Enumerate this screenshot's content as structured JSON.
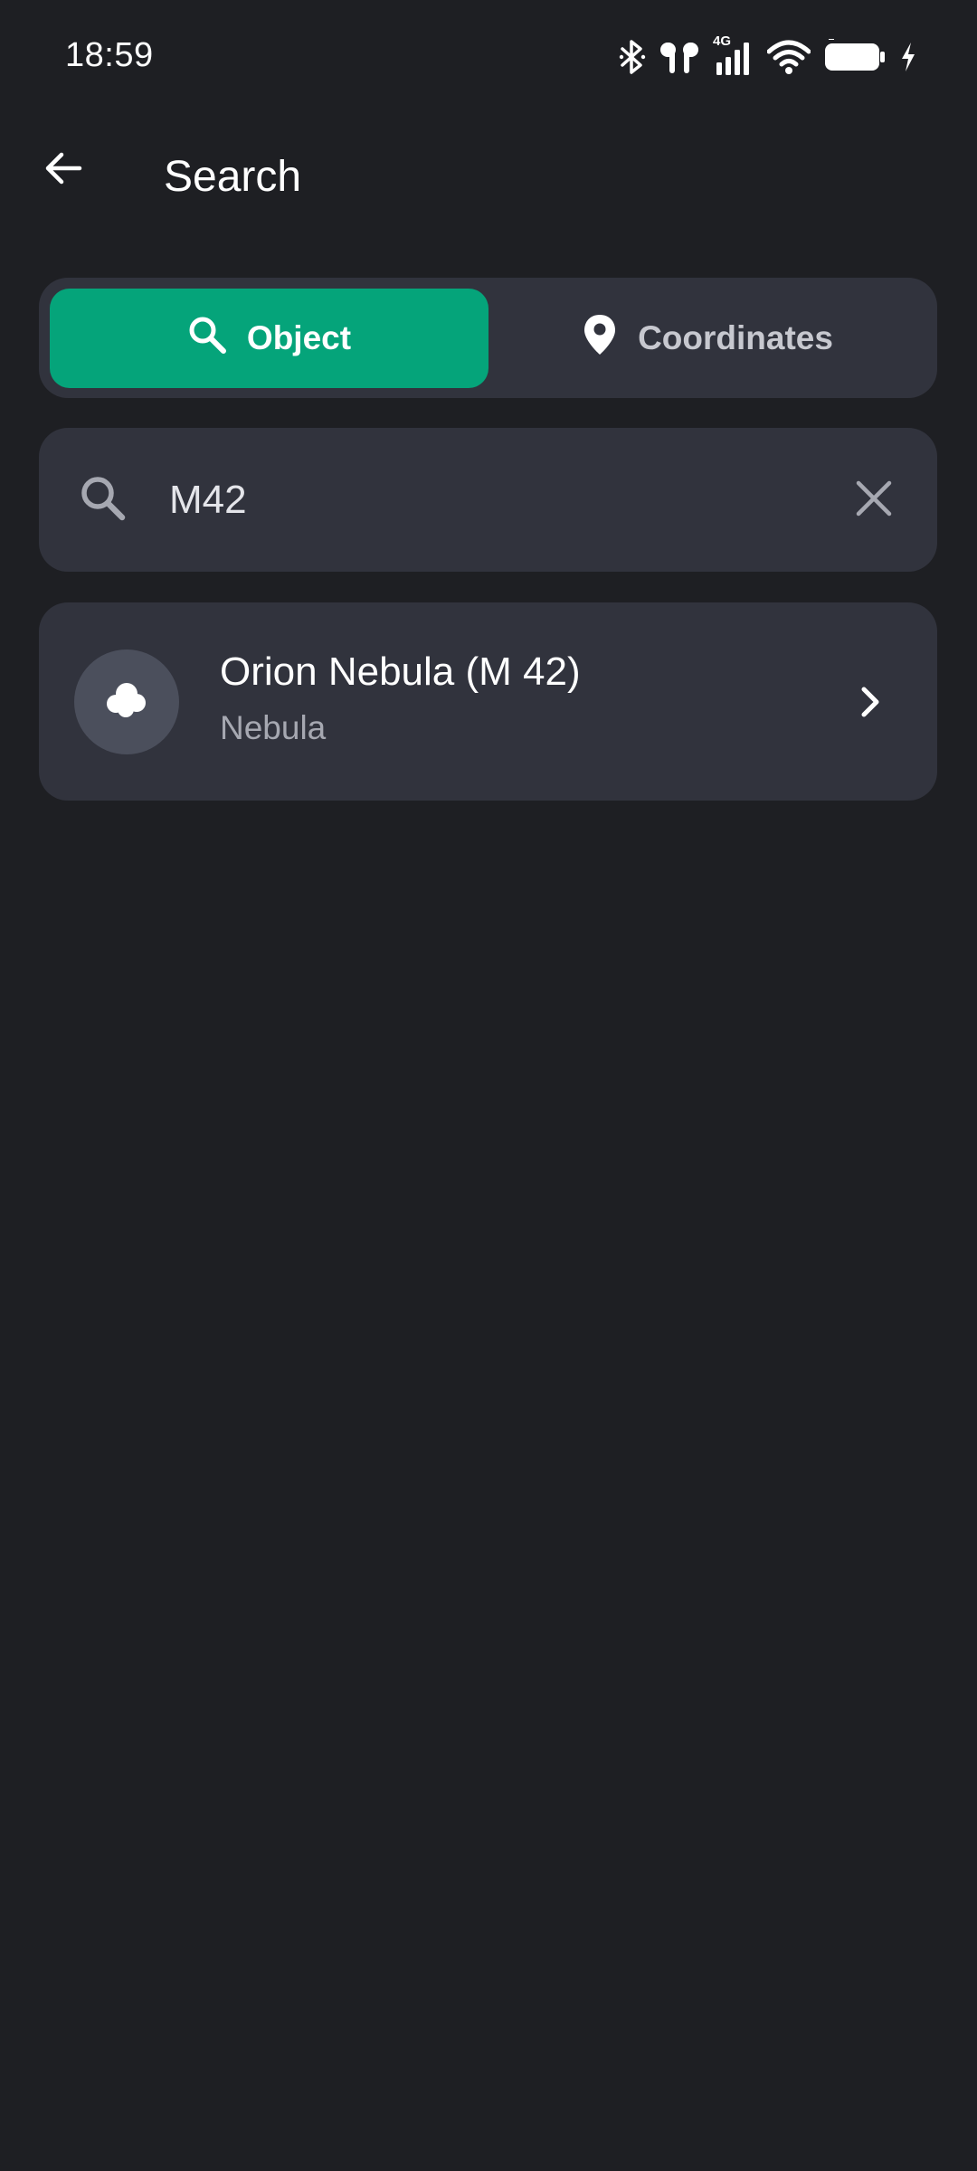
{
  "status_bar": {
    "time": "18:59",
    "network_label": "4G",
    "icons": [
      "bluetooth-icon",
      "earbuds-icon",
      "cellular-signal-icon",
      "wifi-icon",
      "battery-icon",
      "charging-bolt-icon"
    ]
  },
  "header": {
    "title": "Search",
    "back_icon": "arrow-left-icon"
  },
  "tabs": {
    "active": "object",
    "object_label": "Object",
    "object_icon": "search-icon",
    "coordinates_label": "Coordinates",
    "coordinates_icon": "map-pin-icon"
  },
  "search": {
    "value": "M42",
    "placeholder": "",
    "leading_icon": "search-icon",
    "clear_icon": "close-icon"
  },
  "results": [
    {
      "title": "Orion Nebula (M 42)",
      "subtitle": "Nebula",
      "icon": "cloud-icon",
      "trailing_icon": "chevron-right-icon"
    }
  ],
  "colors": {
    "background": "#1e1f23",
    "surface": "#31333d",
    "accent": "#05a47a",
    "avatar_bg": "#4b4f5c",
    "secondary_text": "#a6a8b1"
  }
}
